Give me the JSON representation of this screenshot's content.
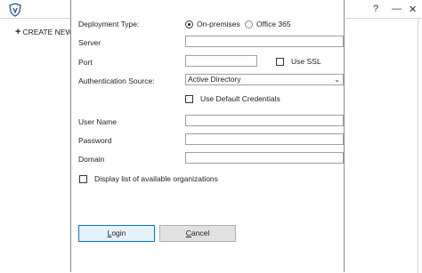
{
  "background": {
    "create_new_label": "CREATE NEW",
    "window_controls": {
      "help": "?",
      "minimize": "—",
      "close": "✕"
    },
    "logo_icon": "shield-logo-icon"
  },
  "dialog": {
    "deployment_type": {
      "label": "Deployment Type:",
      "options": [
        "On-premises",
        "Office 365"
      ],
      "selected": "On-premises"
    },
    "server": {
      "label": "Server",
      "value": ""
    },
    "port": {
      "label": "Port",
      "value": ""
    },
    "use_ssl": {
      "label": "Use SSL",
      "checked": false
    },
    "authentication_source": {
      "label": "Authentication Source:",
      "value": "Active Directory"
    },
    "use_default_credentials": {
      "label": "Use Default Credentials",
      "checked": false
    },
    "user_name": {
      "label": "User Name",
      "value": ""
    },
    "password": {
      "label": "Password",
      "value": ""
    },
    "domain": {
      "label": "Domain",
      "value": ""
    },
    "display_orgs": {
      "label": "Display list of available organizations",
      "checked": false
    },
    "buttons": {
      "login_prefix": "L",
      "login_rest": "ogin",
      "cancel_prefix": "C",
      "cancel_rest": "ancel"
    },
    "accent_color": "#0078d7"
  }
}
